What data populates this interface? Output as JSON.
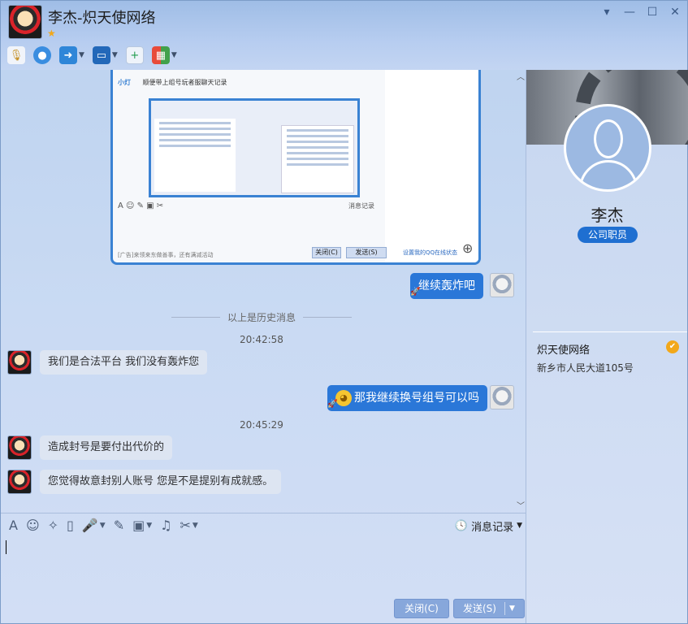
{
  "window": {
    "title": "李杰-炽天使网络",
    "controls": [
      "▾",
      "—",
      "☐",
      "✕"
    ]
  },
  "toolbar": {
    "items": [
      {
        "name": "voice-call",
        "icon": "microphone-icon"
      },
      {
        "name": "video-call",
        "icon": "camera-icon"
      },
      {
        "name": "file-transfer",
        "icon": "folder-icon"
      },
      {
        "name": "remote-desktop",
        "icon": "monitor-icon"
      },
      {
        "name": "add-chat",
        "icon": "chat-add-icon"
      },
      {
        "name": "apps",
        "icon": "apps-icon"
      }
    ]
  },
  "screenshot_preview": {
    "label": "小灯",
    "caption": "顺便带上组号玩者服聊天记录",
    "history_label": "消息记录",
    "ad_text": "[广告]来领来东做善事，还有满减活动",
    "close_label": "关闭(C)",
    "send_label": "发送(S)",
    "qq_status": "设置我的QQ在线状态"
  },
  "messages": {
    "self_1": "继续轰炸吧",
    "divider": "以上是历史消息",
    "time_1": "20:42:58",
    "other_1": "我们是合法平台  我们没有轰炸您",
    "self_2": "那我继续换号组号可以吗",
    "time_2": "20:45:29",
    "other_2": "造成封号是要付出代价的",
    "other_3": "您觉得故意封别人账号 您是不是提别有成就感。"
  },
  "input": {
    "history_label": "消息记录",
    "close_label": "关闭(C)",
    "send_label": "发送(S)"
  },
  "profile": {
    "name": "李杰",
    "role": "公司职员",
    "company": "炽天使网络",
    "address": "新乡市人民大道105号"
  }
}
